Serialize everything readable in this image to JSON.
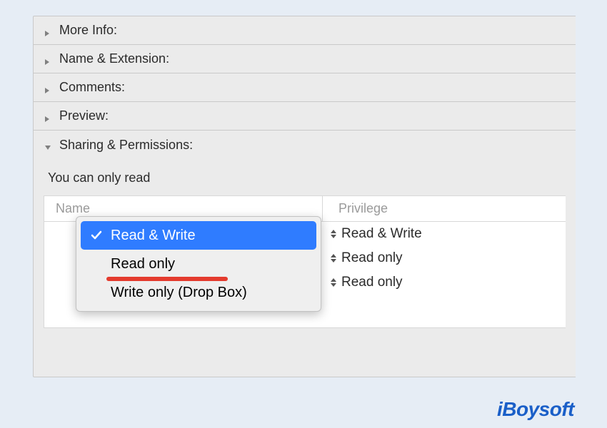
{
  "sections": {
    "more_info": "More Info:",
    "name_ext": "Name & Extension:",
    "comments": "Comments:",
    "preview": "Preview:",
    "sharing": "Sharing & Permissions:"
  },
  "permissions": {
    "status": "You can only read",
    "headers": {
      "name": "Name",
      "privilege": "Privilege"
    },
    "rows": [
      {
        "privilege": "Read & Write"
      },
      {
        "privilege": "Read only"
      },
      {
        "privilege": "Read only"
      }
    ]
  },
  "dropdown": {
    "items": [
      {
        "label": "Read & Write",
        "selected": true
      },
      {
        "label": "Read only",
        "selected": false,
        "annotated": true
      },
      {
        "label": "Write only (Drop Box)",
        "selected": false
      }
    ]
  },
  "brand": "iBoysoft"
}
